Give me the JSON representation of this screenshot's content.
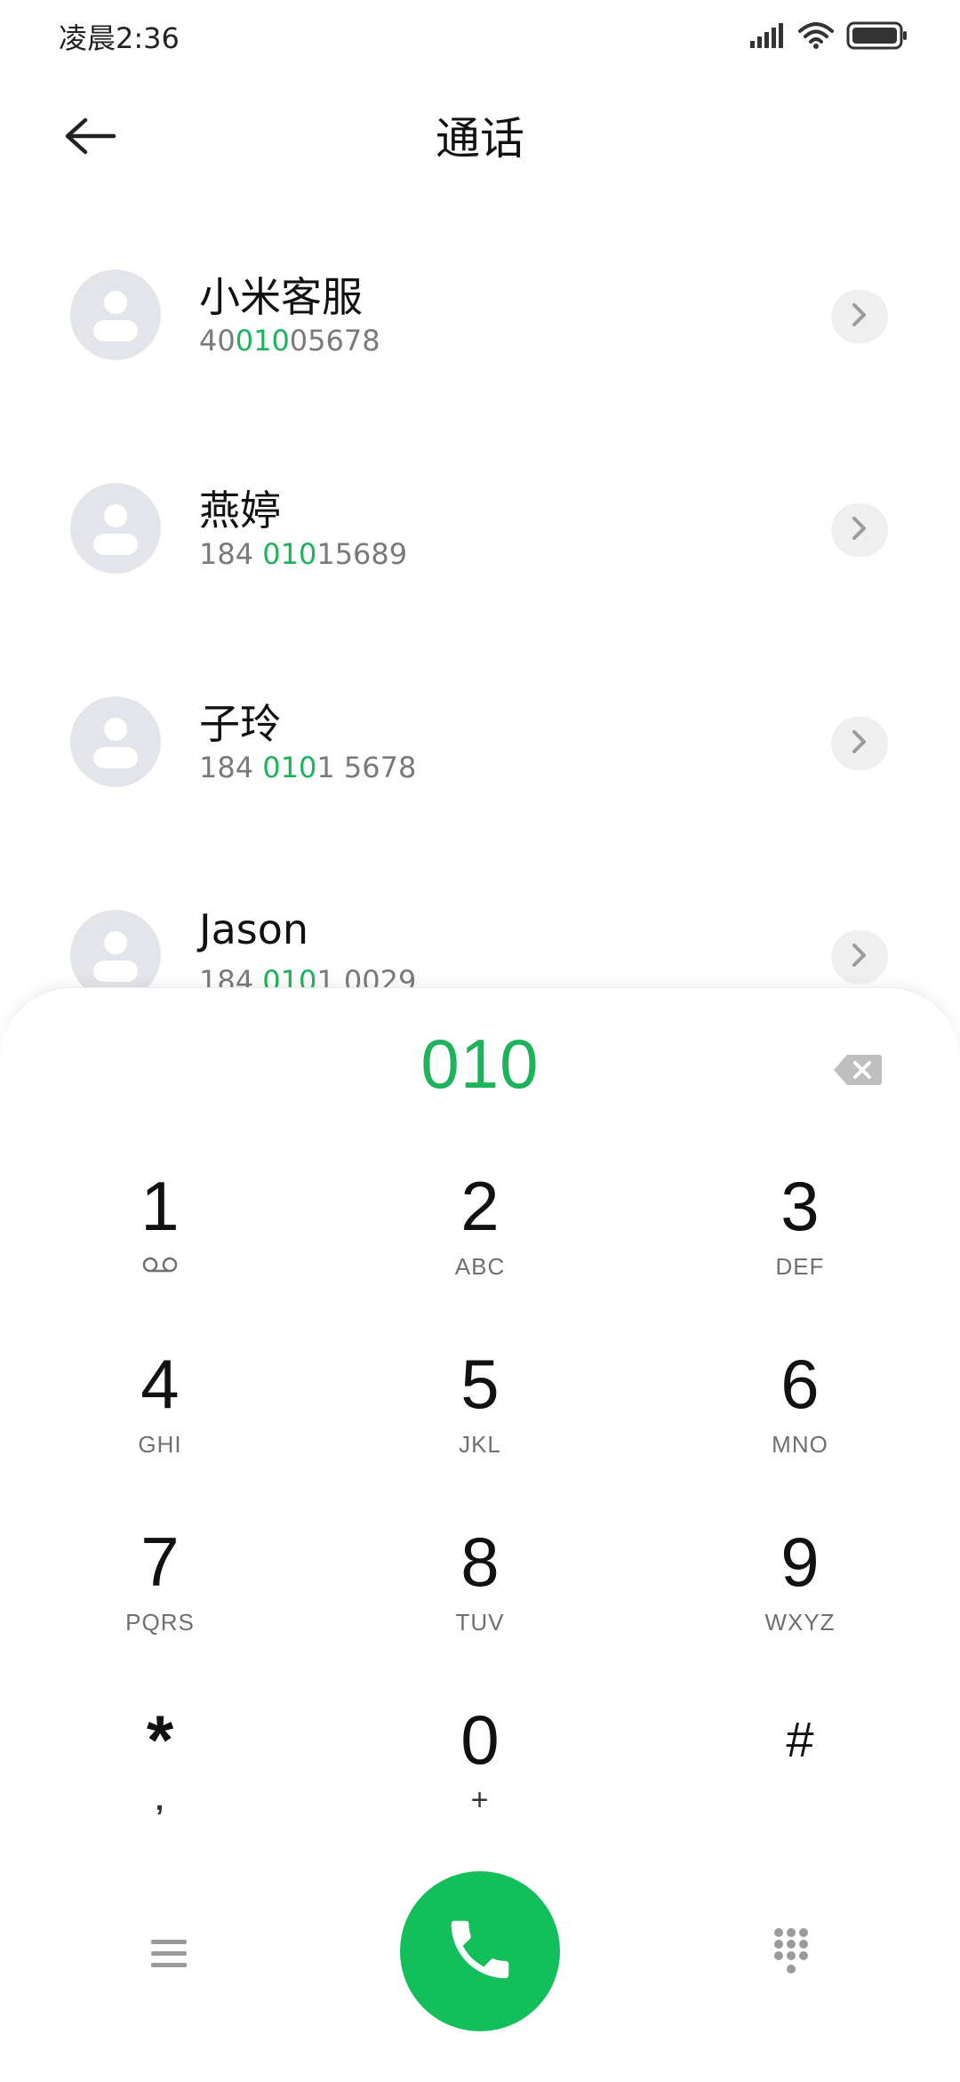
{
  "status_bar": {
    "time": "凌晨2:36",
    "signal_icon": "signal-icon",
    "wifi_icon": "wifi-icon",
    "battery_icon": "battery-icon"
  },
  "header": {
    "back_icon": "back-arrow-icon",
    "title": "通话"
  },
  "contacts": [
    {
      "name": "小米客服",
      "number_pre": "40",
      "number_match": "010",
      "number_post": "05678"
    },
    {
      "name": "燕婷",
      "number_pre": "184 ",
      "number_match": "010",
      "number_post": "15689"
    },
    {
      "name": "子玲",
      "number_pre": "184 ",
      "number_match": "010",
      "number_post": "1 5678"
    },
    {
      "name": "Jason",
      "number_pre": "184 ",
      "number_match": "010",
      "number_post": "1 0029"
    }
  ],
  "dialpad": {
    "dialed": "010",
    "backspace_icon": "backspace-icon",
    "keys": [
      {
        "digit": "1",
        "letters": "",
        "sub_icon": "voicemail-icon"
      },
      {
        "digit": "2",
        "letters": "ABC"
      },
      {
        "digit": "3",
        "letters": "DEF"
      },
      {
        "digit": "4",
        "letters": "GHI"
      },
      {
        "digit": "5",
        "letters": "JKL"
      },
      {
        "digit": "6",
        "letters": "MNO"
      },
      {
        "digit": "7",
        "letters": "PQRS"
      },
      {
        "digit": "8",
        "letters": "TUV"
      },
      {
        "digit": "9",
        "letters": "WXYZ"
      },
      {
        "digit": "*",
        "letters": ","
      },
      {
        "digit": "0",
        "letters": "+"
      },
      {
        "digit": "#",
        "letters": ""
      }
    ]
  },
  "bottom_bar": {
    "menu_icon": "menu-icon",
    "call_icon": "phone-icon",
    "keypad_icon": "keypad-icon"
  },
  "colors": {
    "accent": "#1cb35a",
    "call_button": "#12bf5a",
    "avatar_bg": "#e3e5ea"
  }
}
